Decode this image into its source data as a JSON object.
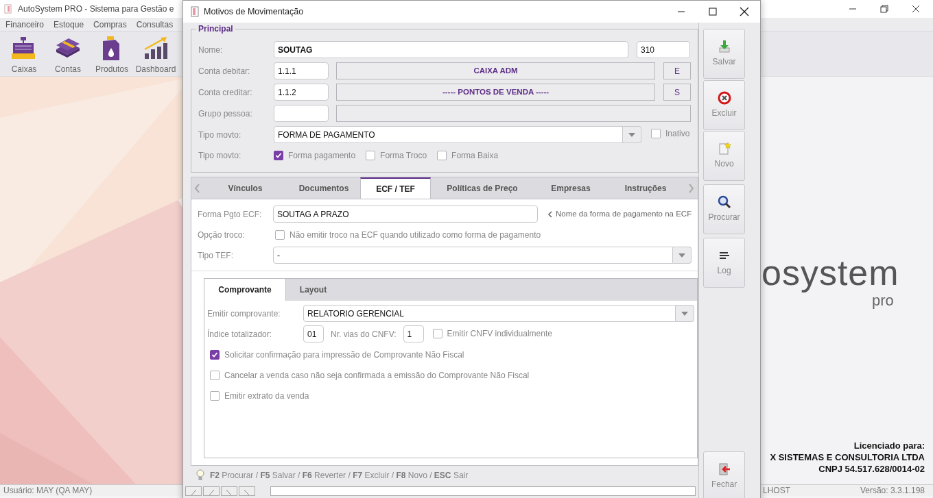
{
  "app": {
    "title": "AutoSystem PRO - Sistema para Gestão e",
    "menu": [
      "Financeiro",
      "Estoque",
      "Compras",
      "Consultas"
    ],
    "toolbar": [
      {
        "label": "Caixas",
        "kind": "register"
      },
      {
        "label": "Contas",
        "kind": "money"
      },
      {
        "label": "Produtos",
        "kind": "jug"
      },
      {
        "label": "Dashboard",
        "kind": "chart"
      }
    ],
    "logo": {
      "word": "osystem",
      "sub": "pro"
    },
    "license": [
      "Licenciado para:",
      "X SISTEMAS E CONSULTORIA LTDA",
      "CNPJ 54.517.628/0014-02"
    ],
    "status_bar": [
      "Usuário: MAY (QA MAY)",
      "LHOST",
      "Versão: 3.3.1.198"
    ]
  },
  "dialog": {
    "title": "Motivos de Movimentação",
    "principal": {
      "legend": "Principal",
      "nome": {
        "label": "Nome:",
        "value": "SOUTAG",
        "code": "310"
      },
      "accounts": [
        {
          "label": "Conta debitar:",
          "code": "1.1.1",
          "name": "CAIXA ADM",
          "flag": "E"
        },
        {
          "label": "Conta creditar:",
          "code": "1.1.2",
          "name": "----- PONTOS DE VENDA -----",
          "flag": "S"
        }
      ],
      "grupo": {
        "label": "Grupo pessoa:"
      },
      "tipo": {
        "label": "Tipo movto:",
        "value": "FORMA DE PAGAMENTO",
        "inativo": {
          "label": "Inativo",
          "checked": false
        }
      },
      "tipo_checks": {
        "label": "Tipo movto:",
        "options": [
          {
            "label": "Forma pagamento",
            "checked": true
          },
          {
            "label": "Forma Troco",
            "checked": false
          },
          {
            "label": "Forma Baixa",
            "checked": false
          }
        ]
      }
    },
    "tabs": [
      {
        "label": "Vínculos",
        "selected": false
      },
      {
        "label": "Documentos",
        "selected": false
      },
      {
        "label": "ECF / TEF",
        "selected": true
      },
      {
        "label": "Políticas de Preço",
        "selected": false
      },
      {
        "label": "Empresas",
        "selected": false
      },
      {
        "label": "Instruções",
        "selected": false
      }
    ],
    "ecf": {
      "forma": {
        "label": "Forma Pgto ECF:",
        "value": "SOUTAG A PRAZO",
        "hint": "Nome da forma de pagamento na ECF"
      },
      "troco": {
        "label": "Opção troco:",
        "option": {
          "label": "Não emitir troco na ECF quando utilizado como forma de pagamento",
          "checked": false
        }
      },
      "tef": {
        "label": "Tipo TEF:",
        "value": "-"
      },
      "subtabs": [
        {
          "label": "Comprovante",
          "selected": true
        },
        {
          "label": "Layout",
          "selected": false
        }
      ],
      "emitir": {
        "label": "Emitir comprovante:",
        "value": "RELATORIO GERENCIAL"
      },
      "indice": {
        "label": "Índice totalizador:",
        "value": "01"
      },
      "vias": {
        "label": "Nr. vias do CNFV:",
        "value": "1"
      },
      "individual": {
        "label": "Emitir CNFV individualmente",
        "checked": false
      },
      "options": [
        {
          "label": "Solicitar confirmação para impressão de Comprovante Não Fiscal",
          "checked": true
        },
        {
          "label": "Cancelar a venda caso não seja confirmada a emissão do Comprovante Não Fiscal",
          "checked": false
        },
        {
          "label": "Emitir extrato da venda",
          "checked": false
        }
      ]
    },
    "shortcuts": "**F2** Procurar / **F5** Salvar / **F6** Reverter / **F7** Excluir / **F8** Novo / **ESC** Sair",
    "actions": [
      {
        "label": "Salvar",
        "kind": "save"
      },
      {
        "label": "Excluir",
        "kind": "delete"
      },
      {
        "label": "Novo",
        "kind": "new"
      },
      {
        "label": "Procurar",
        "kind": "search"
      },
      {
        "label": "Log",
        "kind": "log"
      }
    ],
    "close_action": {
      "label": "Fechar"
    }
  }
}
